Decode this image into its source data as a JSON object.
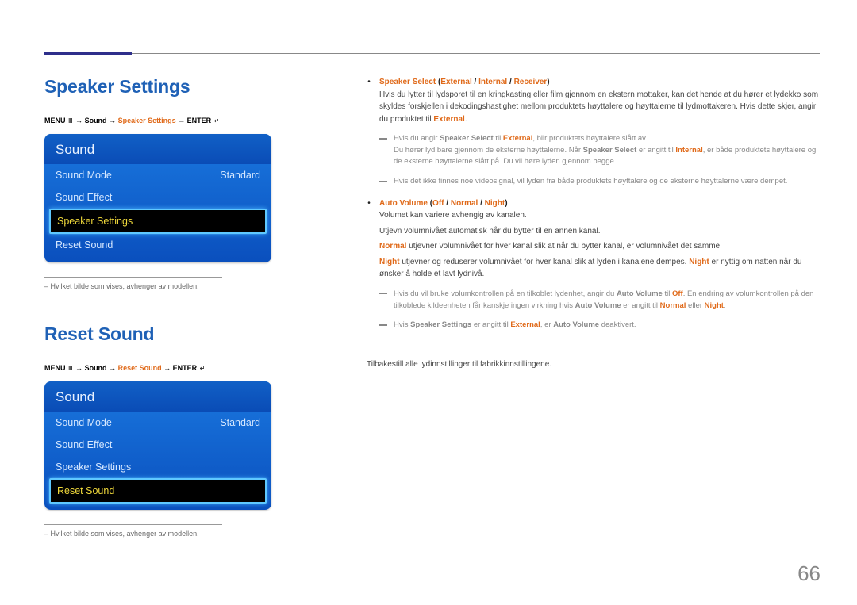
{
  "page_number": "66",
  "sections": {
    "speaker_settings": {
      "title": "Speaker Settings",
      "breadcrumb": {
        "menu": "MENU",
        "arrow": "→",
        "sound": "Sound",
        "current": "Speaker Settings",
        "enter": "ENTER"
      },
      "osd": {
        "title": "Sound",
        "rows": {
          "sound_mode": {
            "label": "Sound Mode",
            "value": "Standard"
          },
          "sound_effect": {
            "label": "Sound Effect"
          },
          "speaker_settings": {
            "label": "Speaker Settings"
          },
          "reset_sound": {
            "label": "Reset Sound"
          }
        }
      },
      "note": "Hvilket bilde som vises, avhenger av modellen."
    },
    "reset_sound": {
      "title": "Reset Sound",
      "breadcrumb": {
        "menu": "MENU",
        "arrow": "→",
        "sound": "Sound",
        "current": "Reset Sound",
        "enter": "ENTER"
      },
      "osd": {
        "title": "Sound",
        "rows": {
          "sound_mode": {
            "label": "Sound Mode",
            "value": "Standard"
          },
          "sound_effect": {
            "label": "Sound Effect"
          },
          "speaker_settings": {
            "label": "Speaker Settings"
          },
          "reset_sound": {
            "label": "Reset Sound"
          }
        }
      },
      "note": "Hvilket bilde som vises, avhenger av modellen."
    }
  },
  "right": {
    "bullet1": {
      "label": "Speaker Select",
      "paren_open": " (",
      "opt1": "External",
      "sep": " / ",
      "opt2": "Internal",
      "opt3": "Receiver",
      "paren_close": ")",
      "p1a": "Hvis du lytter til lydsporet til en kringkasting eller film gjennom en ekstern mottaker, kan det hende at du hører et lydekko som skyldes forskjellen i dekodingshastighet mellom produktets høyttalere og høyttalerne til lydmottakeren. Hvis dette skjer, angir du produktet til ",
      "p1b": "External",
      "p1c": ".",
      "sub1a": "Hvis du angir ",
      "sub1b": "Speaker Select",
      "sub1c": " til ",
      "sub1d": "External",
      "sub1e": ", blir produktets høyttalere slått av.",
      "sub2a": "Du hører lyd bare gjennom de eksterne høyttalerne. Når ",
      "sub2b": "Speaker Select",
      "sub2c": " er angitt til ",
      "sub2d": "Internal",
      "sub2e": ", er både produktets høyttalere og de eksterne høyttalerne slått på. Du vil høre lyden gjennom begge.",
      "sub3": "Hvis det ikke finnes noe videosignal, vil lyden fra både produktets høyttalere og de eksterne høyttalerne være dempet."
    },
    "bullet2": {
      "label": "Auto Volume",
      "paren_open": " (",
      "opt1": "Off",
      "sep": " / ",
      "opt2": "Normal",
      "opt3": "Night",
      "paren_close": ")",
      "p1": "Volumet kan variere avhengig av kanalen.",
      "p2": "Utjevn volumnivået automatisk når du bytter til en annen kanal.",
      "p3a": "Normal",
      "p3b": " utjevner volumnivået for hver kanal slik at når du bytter kanal, er volumnivået det samme.",
      "p4a": "Night",
      "p4b": " utjevner og reduserer volumnivået for hver kanal slik at lyden i kanalene dempes. ",
      "p4c": "Night",
      "p4d": " er nyttig om natten når du ønsker å holde et lavt lydnivå.",
      "sub1a": "Hvis du vil bruke volumkontrollen på en tilkoblet lydenhet, angir du ",
      "sub1b": "Auto Volume",
      "sub1c": " til ",
      "sub1d": "Off",
      "sub1e": ". En endring av volumkontrollen på den tilkoblede kildeenheten får kanskje ingen virkning hvis ",
      "sub1f": "Auto Volume",
      "sub1g": " er angitt til ",
      "sub1h": "Normal",
      "sub1i": " eller ",
      "sub1j": "Night",
      "sub1k": ".",
      "sub2a": "Hvis ",
      "sub2b": "Speaker Settings",
      "sub2c": " er angitt til ",
      "sub2d": "External",
      "sub2e": ", er ",
      "sub2f": "Auto Volume",
      "sub2g": " deaktivert."
    },
    "reset_desc": "Tilbakestill alle lydinnstillinger til fabrikkinnstillingene."
  }
}
